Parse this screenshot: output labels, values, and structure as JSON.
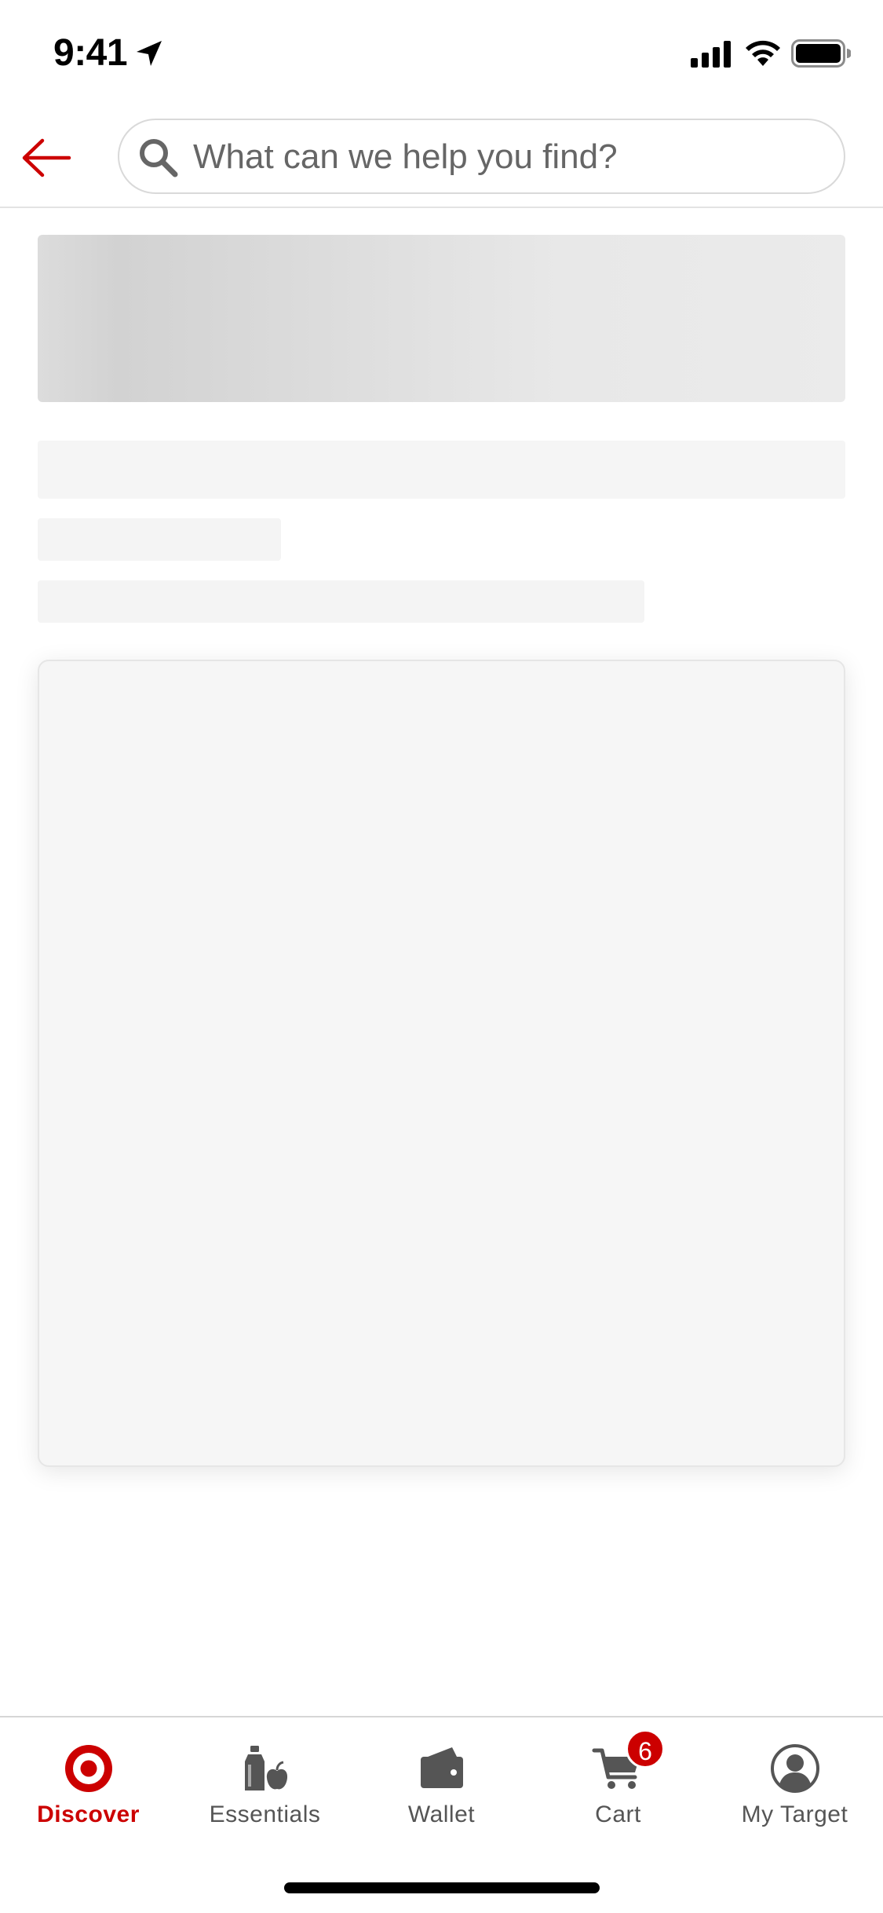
{
  "status_bar": {
    "time": "9:41"
  },
  "header": {
    "back_icon": "arrow-left-icon",
    "search": {
      "placeholder": "What can we help you find?",
      "value": "",
      "icon": "search-icon"
    }
  },
  "colors": {
    "brand": "#cc0000",
    "skeleton": "#f5f5f5",
    "tab_inactive": "#555555"
  },
  "tab_bar": {
    "tabs": [
      {
        "label": "Discover",
        "icon": "target-logo-icon",
        "active": true
      },
      {
        "label": "Essentials",
        "icon": "essentials-icon",
        "active": false
      },
      {
        "label": "Wallet",
        "icon": "wallet-icon",
        "active": false
      },
      {
        "label": "Cart",
        "icon": "cart-icon",
        "active": false,
        "badge": "6"
      },
      {
        "label": "My Target",
        "icon": "profile-icon",
        "active": false
      }
    ]
  }
}
